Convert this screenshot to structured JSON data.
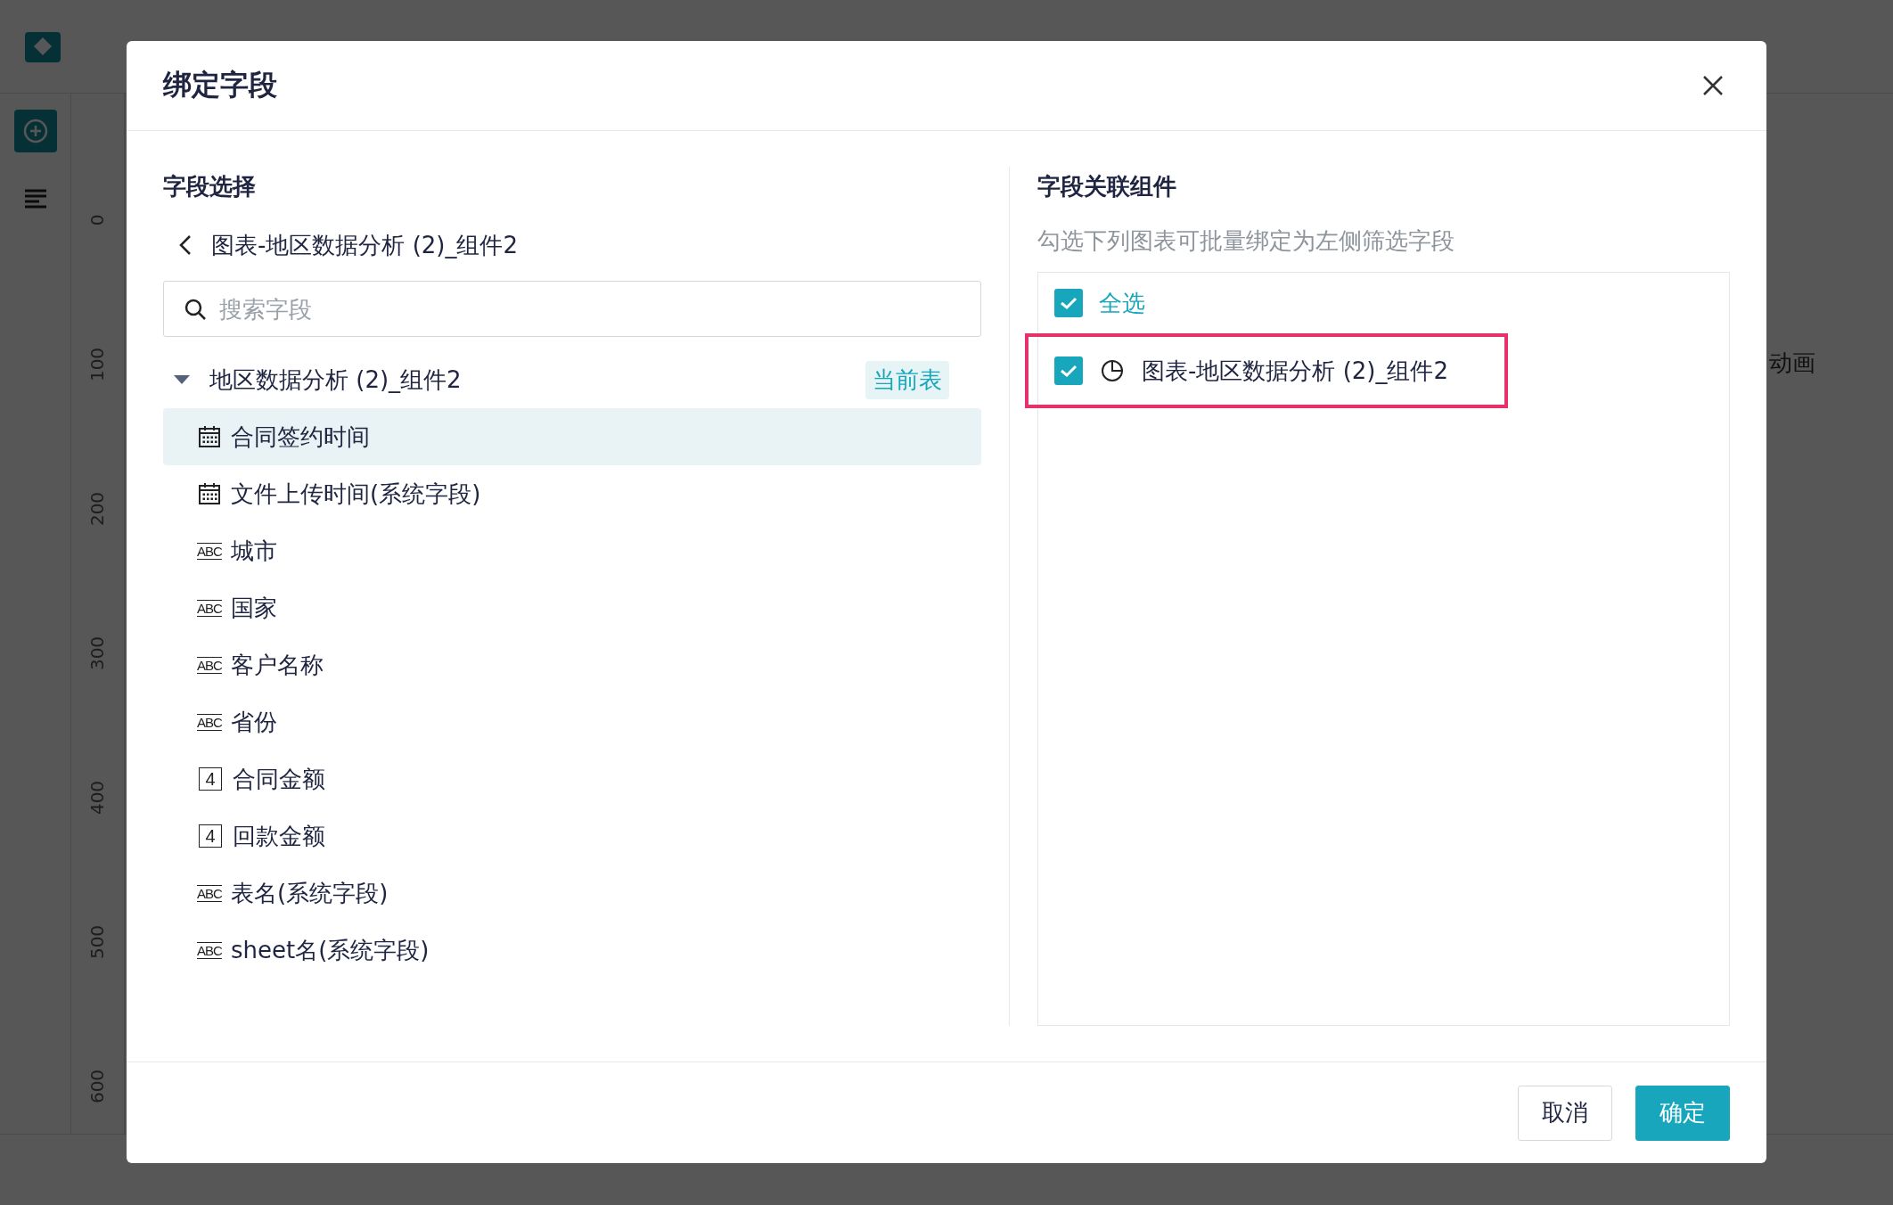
{
  "background": {
    "ruler_labels": [
      "0",
      "100",
      "200",
      "300",
      "400",
      "500",
      "600"
    ],
    "panel_label": "动画"
  },
  "dialog": {
    "title": "绑定字段",
    "left": {
      "heading": "字段选择",
      "breadcrumb": "图表-地区数据分析 (2)_组件2",
      "search": {
        "placeholder": "搜索字段"
      },
      "table": {
        "name": "地区数据分析 (2)_组件2",
        "expanded": true,
        "badge": "当前表"
      },
      "fields": [
        {
          "kind": "date",
          "label": "合同签约时间",
          "selected": true
        },
        {
          "kind": "date",
          "label": "文件上传时间(系统字段)",
          "selected": false
        },
        {
          "kind": "text",
          "icon": "ABC",
          "label": "城市",
          "selected": false
        },
        {
          "kind": "text",
          "icon": "ABC",
          "label": "国家",
          "selected": false
        },
        {
          "kind": "text",
          "icon": "ABC",
          "label": "客户名称",
          "selected": false
        },
        {
          "kind": "text",
          "icon": "ABC",
          "label": "省份",
          "selected": false
        },
        {
          "kind": "number",
          "icon": "4",
          "label": "合同金额",
          "selected": false
        },
        {
          "kind": "number",
          "icon": "4",
          "label": "回款金额",
          "selected": false
        },
        {
          "kind": "text",
          "icon": "ABC",
          "label": "表名(系统字段)",
          "selected": false
        },
        {
          "kind": "text",
          "icon": "ABC",
          "label": "sheet名(系统字段)",
          "selected": false
        }
      ]
    },
    "right": {
      "heading": "字段关联组件",
      "hint": "勾选下列图表可批量绑定为左侧筛选字段",
      "select_all": {
        "label": "全选",
        "checked": true
      },
      "components": [
        {
          "label": "图表-地区数据分析 (2)_组件2",
          "checked": true,
          "highlighted": true
        }
      ]
    },
    "buttons": [
      {
        "kind": "secondary",
        "label": "取消"
      },
      {
        "kind": "primary",
        "label": "确定"
      }
    ]
  }
}
